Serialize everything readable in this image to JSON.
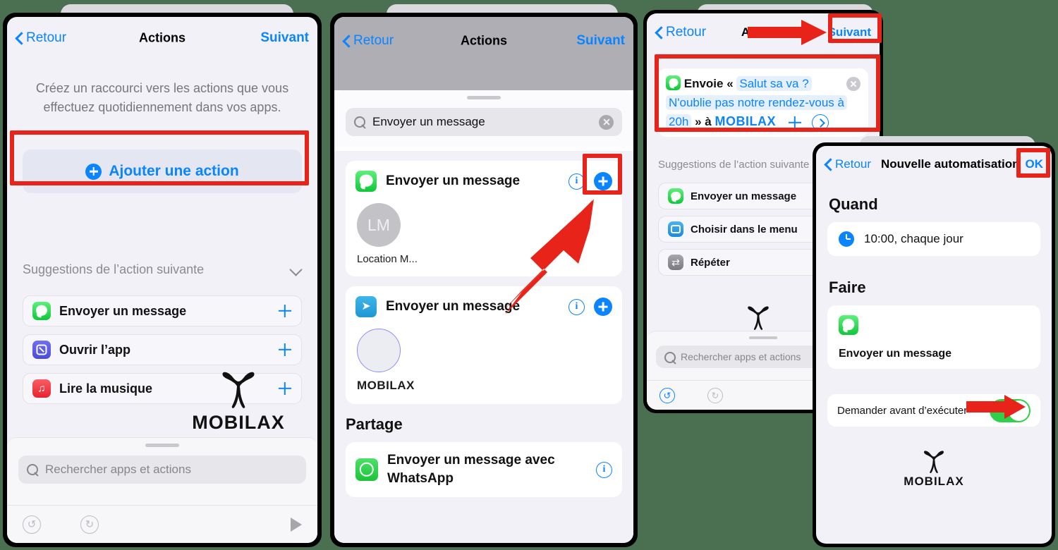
{
  "meta": {
    "background_color": "#4a7051",
    "accent_blue": "#0a84ff",
    "annotation_red": "#e8231a",
    "toggle_green": "#2fd14a"
  },
  "watermark": {
    "text": "MOBILAX"
  },
  "panel1": {
    "nav": {
      "back": "Retour",
      "title": "Actions",
      "next": "Suivant"
    },
    "description": "Créez un raccourci vers les actions que vous effectuez quotidiennement dans vos apps.",
    "add_action_label": "Ajouter une action",
    "suggestions_header": "Suggestions de l’action suivante",
    "suggestions": [
      {
        "label": "Envoyer un message",
        "icon": "messages-icon"
      },
      {
        "label": "Ouvrir l’app",
        "icon": "open-app-icon"
      },
      {
        "label": "Lire la musique",
        "icon": "music-icon"
      }
    ],
    "search_placeholder": "Rechercher apps et actions",
    "toolbar": {
      "undo": "undo-icon",
      "redo": "redo-icon",
      "run": "play-icon"
    }
  },
  "panel2": {
    "nav": {
      "back": "Retour",
      "title": "Actions",
      "next": "Suivant"
    },
    "search_value": "Envoyer un message",
    "results": [
      {
        "label": "Envoyer un message",
        "icon": "messages-icon",
        "avatar_initials": "LM",
        "avatar_caption": "Location M...",
        "has_info": true,
        "has_add": true
      },
      {
        "label": "Envoyer un message",
        "icon": "telegram-icon",
        "preview_caption": "MOBILAX",
        "has_info": true,
        "has_add": true
      }
    ],
    "section_header": "Partage",
    "share_items": [
      {
        "label": "Envoyer un message avec WhatsApp",
        "icon": "whatsapp-icon",
        "has_info": true
      }
    ]
  },
  "panel3": {
    "nav": {
      "back": "Retour",
      "title": "Actions",
      "next": "Suivant"
    },
    "message_action": {
      "icon": "messages-icon",
      "prefix": "Envoie «",
      "token1": "Salut sa va ?",
      "token2": "N'oublie pas notre rendez-vous à",
      "token3": "20h",
      "middle": "» à",
      "recipient": "MOBILAX"
    },
    "suggestions_header": "Suggestions de l’action suivante",
    "suggestions": [
      {
        "label": "Envoyer un message",
        "icon": "messages-icon"
      },
      {
        "label": "Choisir dans le menu",
        "icon": "menu-icon"
      },
      {
        "label": "Répéter",
        "icon": "repeat-icon"
      }
    ],
    "search_placeholder": "Rechercher apps et actions",
    "toolbar": {
      "undo": "undo-icon",
      "redo": "redo-icon"
    }
  },
  "panel4": {
    "nav": {
      "back": "Retour",
      "title": "Nouvelle automatisation",
      "ok": "OK"
    },
    "when_title": "Quand",
    "when_value": "10:00, chaque jour",
    "do_title": "Faire",
    "do_action": {
      "label": "Envoyer un message",
      "icon": "messages-icon"
    },
    "ask_before_label": "Demander avant d’exécuter",
    "ask_before_state": "on"
  }
}
